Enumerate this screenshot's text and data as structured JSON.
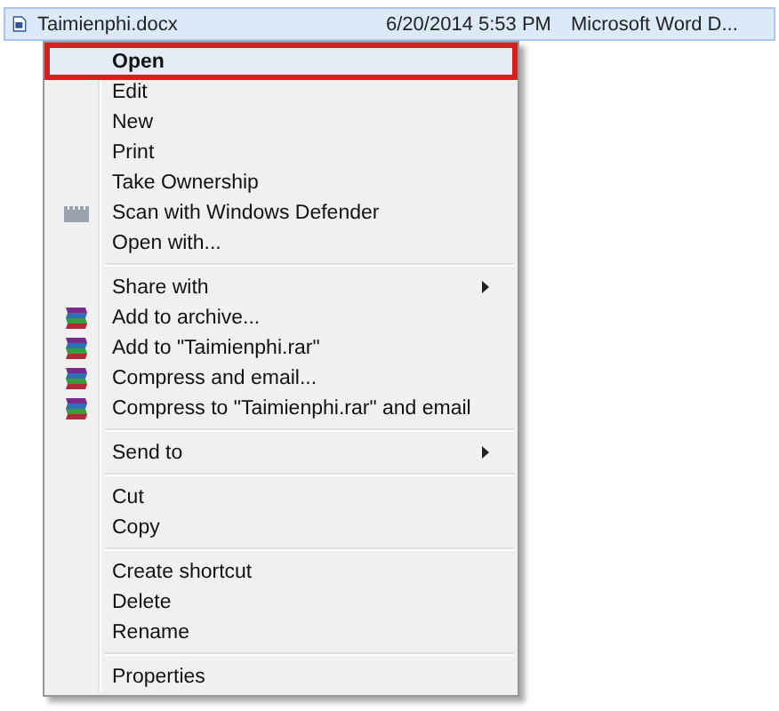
{
  "file_row": {
    "name": "Taimienphi.docx",
    "date": "6/20/2014 5:53 PM",
    "type": "Microsoft Word D...",
    "selected": true
  },
  "context_menu": {
    "groups": [
      {
        "items": [
          {
            "label": "Open",
            "default": true,
            "selected": true,
            "kind": "plain",
            "submenu": false
          },
          {
            "label": "Edit",
            "default": false,
            "selected": false,
            "kind": "plain",
            "submenu": false
          },
          {
            "label": "New",
            "default": false,
            "selected": false,
            "kind": "plain",
            "submenu": false
          },
          {
            "label": "Print",
            "default": false,
            "selected": false,
            "kind": "plain",
            "submenu": false
          },
          {
            "label": "Take Ownership",
            "default": false,
            "selected": false,
            "kind": "plain",
            "submenu": false
          },
          {
            "label": "Scan with Windows Defender",
            "default": false,
            "selected": false,
            "kind": "defender",
            "submenu": false
          },
          {
            "label": "Open with...",
            "default": false,
            "selected": false,
            "kind": "plain",
            "submenu": false
          }
        ]
      },
      {
        "items": [
          {
            "label": "Share with",
            "default": false,
            "selected": false,
            "kind": "plain",
            "submenu": true
          },
          {
            "label": "Add to archive...",
            "default": false,
            "selected": false,
            "kind": "archive",
            "submenu": false
          },
          {
            "label": "Add to \"Taimienphi.rar\"",
            "default": false,
            "selected": false,
            "kind": "archive",
            "submenu": false
          },
          {
            "label": "Compress and email...",
            "default": false,
            "selected": false,
            "kind": "archive",
            "submenu": false
          },
          {
            "label": "Compress to \"Taimienphi.rar\" and email",
            "default": false,
            "selected": false,
            "kind": "archive",
            "submenu": false
          }
        ]
      },
      {
        "items": [
          {
            "label": "Send to",
            "default": false,
            "selected": false,
            "kind": "plain",
            "submenu": true
          }
        ]
      },
      {
        "items": [
          {
            "label": "Cut",
            "default": false,
            "selected": false,
            "kind": "plain",
            "submenu": false
          },
          {
            "label": "Copy",
            "default": false,
            "selected": false,
            "kind": "plain",
            "submenu": false
          }
        ]
      },
      {
        "items": [
          {
            "label": "Create shortcut",
            "default": false,
            "selected": false,
            "kind": "plain",
            "submenu": false
          },
          {
            "label": "Delete",
            "default": false,
            "selected": false,
            "kind": "plain",
            "submenu": false
          },
          {
            "label": "Rename",
            "default": false,
            "selected": false,
            "kind": "plain",
            "submenu": false
          }
        ]
      },
      {
        "items": [
          {
            "label": "Properties",
            "default": false,
            "selected": false,
            "kind": "plain",
            "submenu": false
          }
        ]
      }
    ]
  }
}
